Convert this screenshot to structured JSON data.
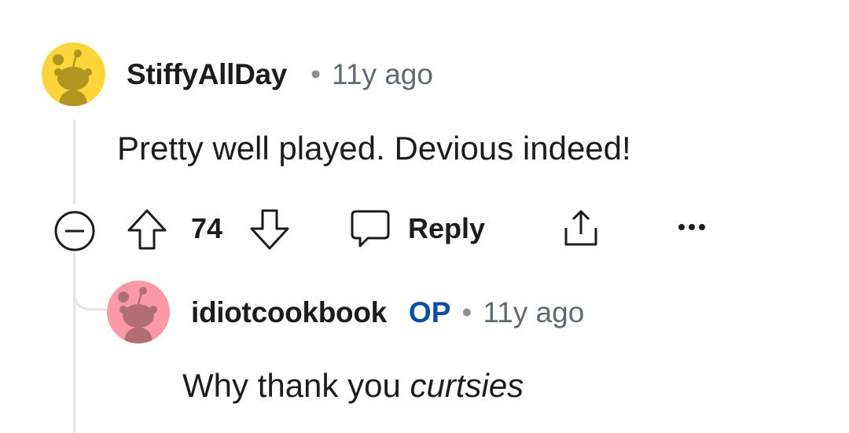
{
  "comment": {
    "username": "StiffyAllDay",
    "time": "11y ago",
    "body": "Pretty well played. Devious indeed!",
    "score": "74",
    "reply_label": "Reply",
    "avatar_color": "#fbd53a"
  },
  "reply": {
    "username": "idiotcookbook",
    "op_label": "OP",
    "time": "11y ago",
    "body_text": "Why thank you ",
    "body_emphasis": "curtsies",
    "avatar_color": "#fb9aa6"
  },
  "icons": [
    "collapse-icon",
    "upvote-icon",
    "downvote-icon",
    "reply-icon",
    "share-icon",
    "more-icon"
  ],
  "colors": {
    "op": "#0b4da8",
    "thread_line": "#e4e6e8",
    "meta_gray": "#5f6b72"
  }
}
